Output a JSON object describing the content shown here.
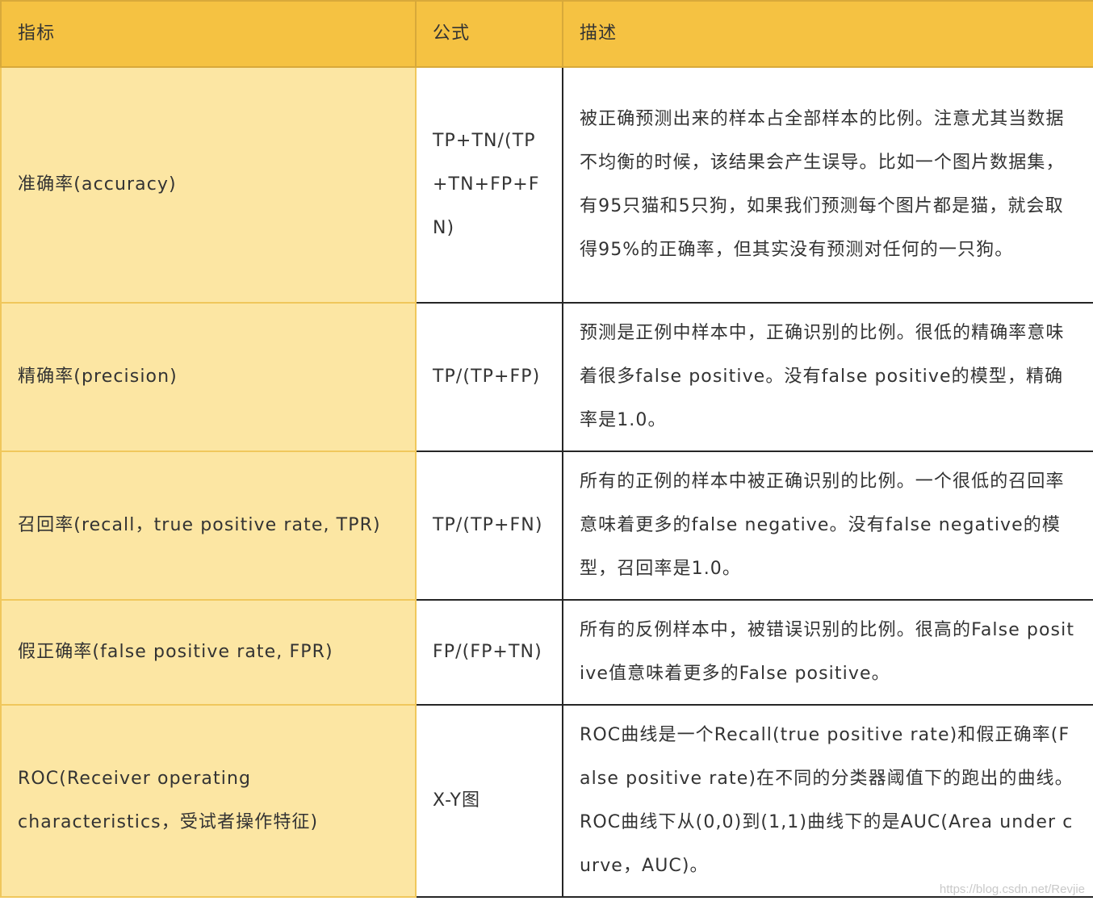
{
  "table": {
    "headers": [
      "指标",
      "公式",
      "描述"
    ],
    "rows": [
      {
        "name": "准确率(accuracy)",
        "formula": "TP+TN/(TP+TN+FP+FN)",
        "description": "被正确预测出来的样本占全部样本的比例。注意尤其当数据不均衡的时候，该结果会产生误导。比如一个图片数据集，有95只猫和5只狗，如果我们预测每个图片都是猫，就会取得95%的正确率，但其实没有预测对任何的一只狗。"
      },
      {
        "name": "精确率(precision)",
        "formula": "TP/(TP+FP)",
        "description": "预测是正例中样本中，正确识别的比例。很低的精确率意味着很多false positive。没有false positive的模型，精确率是1.0。"
      },
      {
        "name": "召回率(recall，true positive rate, TPR)",
        "formula": "TP/(TP+FN)",
        "description": "所有的正例的样本中被正确识别的比例。一个很低的召回率意味着更多的false negative。没有false negative的模型，召回率是1.0。"
      },
      {
        "name": "假正确率(false positive rate, FPR)",
        "formula": "FP/(FP+TN)",
        "description": "所有的反例样本中，被错误识别的比例。很高的False positive值意味着更多的False positive。"
      },
      {
        "name": "ROC(Receiver operating characteristics，受试者操作特征)",
        "formula": "X-Y图",
        "description": "ROC曲线是一个Recall(true positive rate)和假正确率(False positive rate)在不同的分类器阈值下的跑出的曲线。ROC曲线下从(0,0)到(1,1)曲线下的是AUC(Area under curve，AUC)。"
      }
    ]
  },
  "watermark": "https://blog.csdn.net/Revjie"
}
